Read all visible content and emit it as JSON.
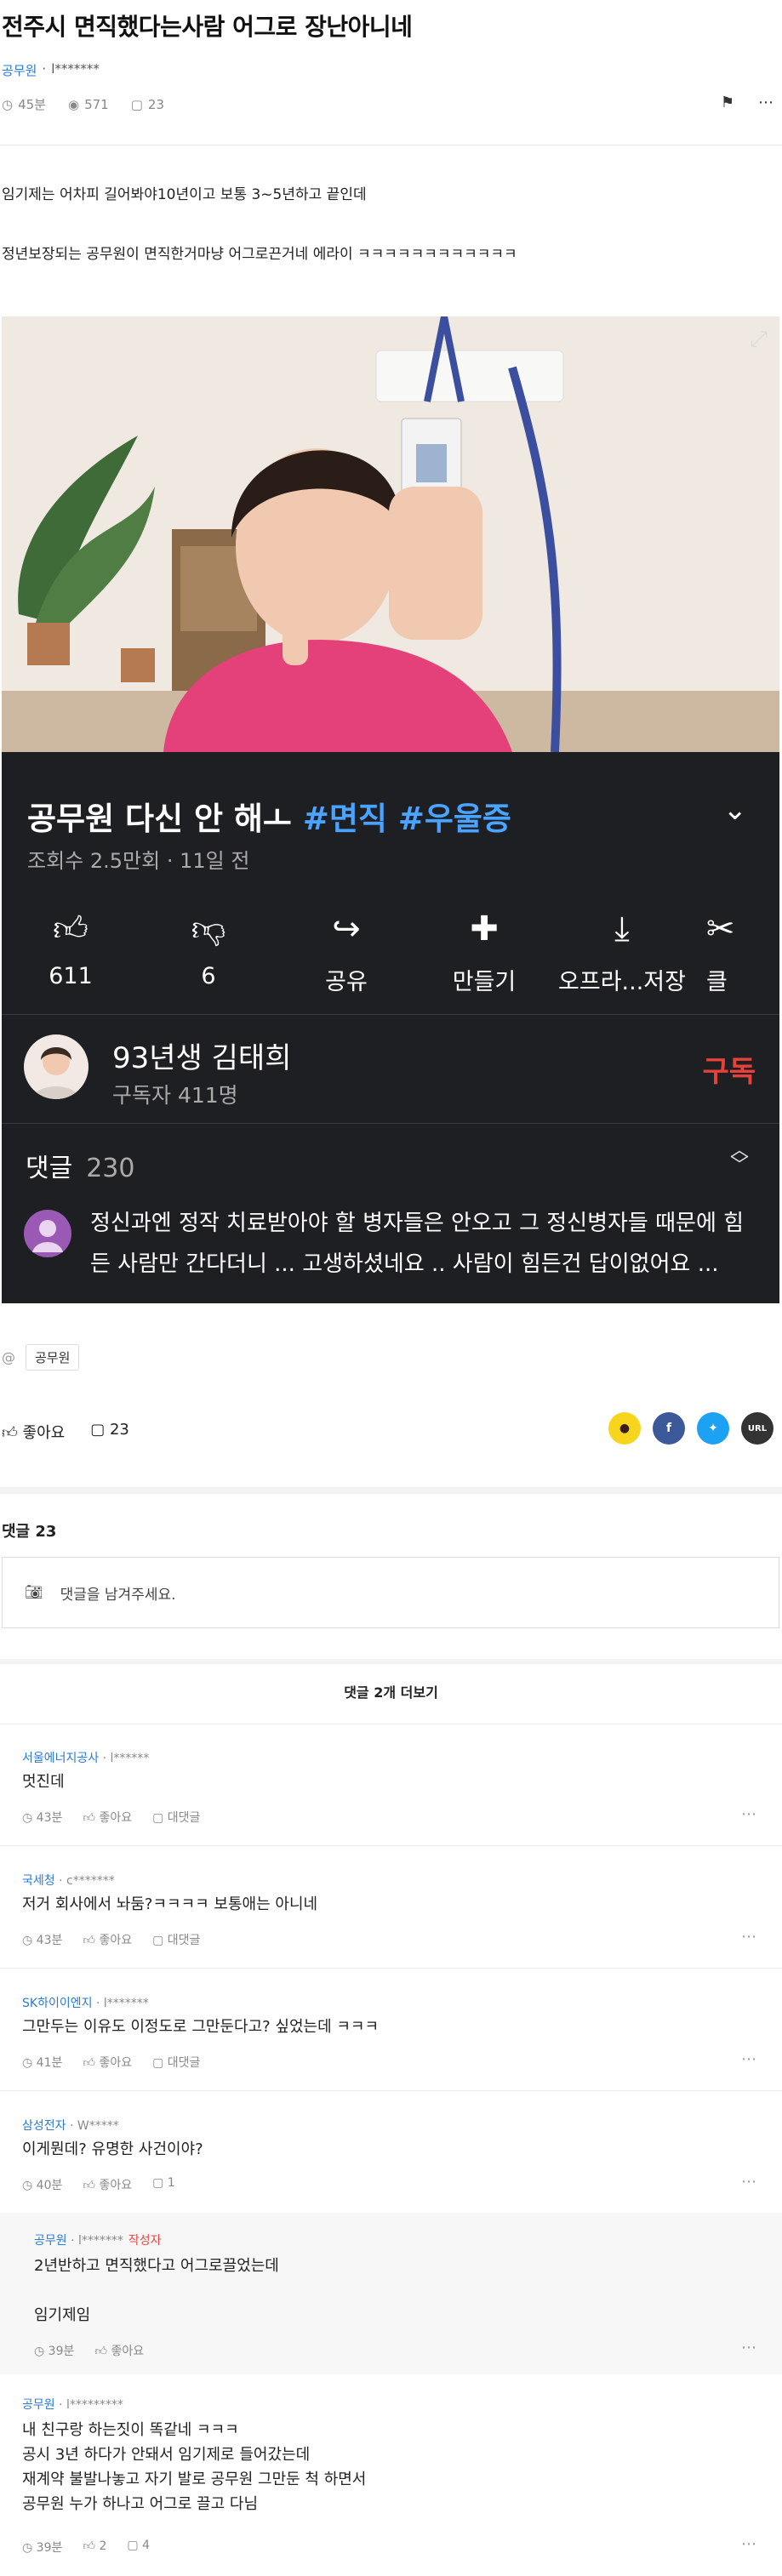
{
  "post": {
    "title": "전주시 면직했다는사람 어그로 장난아니네",
    "company": "공무원",
    "author": "l*******",
    "time": "45분",
    "views": "571",
    "comments": "23",
    "paragraph1": "임기제는 어차피 길어봐야10년이고 보통 3~5년하고 끝인데",
    "paragraph2": "정년보장되는 공무원이 면직한거마냥 어그로끈거네 에라이 ㅋㅋㅋㅋㅋㅋㅋㅋㅋㅋㅋㅋ"
  },
  "video": {
    "title_main": "공무원 다신 안 해ㅗ",
    "tag1": "#면직",
    "tag2": "#우울증",
    "views_date": "조회수 2.5만회 · 11일 전",
    "actions": [
      {
        "icon": "thumb-up-icon",
        "label": "611"
      },
      {
        "icon": "thumb-down-icon",
        "label": "6"
      },
      {
        "icon": "share-icon",
        "label": "공유"
      },
      {
        "icon": "remix-icon",
        "label": "만들기"
      },
      {
        "icon": "download-icon",
        "label": "오프라...저장"
      },
      {
        "icon": "scissors-icon",
        "label": "클"
      }
    ],
    "channel_name": "93년생 김태희",
    "subscribers": "구독자 411명",
    "subscribe_label": "구독",
    "comments_label": "댓글",
    "comments_count": "230",
    "top_comment": "정신과엔 정작 치료받아야 할 병자들은 안오고 그 정신병자들 때문에 힘든 사람만 간다더니 ... 고생하셨네요 .. 사람이 힘든건 답이없어요 ..."
  },
  "tag_label": "공무원",
  "actions": {
    "like_label": "좋아요",
    "comment_count": "23"
  },
  "share": {
    "kakao": "kakao-icon",
    "facebook": "f",
    "twitter": "twitter-icon",
    "url": "URL"
  },
  "comment_section": {
    "header": "댓글 23",
    "placeholder": "댓글을 남겨주세요.",
    "more_label": "댓글 2개 더보기"
  },
  "comments": [
    {
      "company": "서울에너지공사",
      "author": "l******",
      "body": "멋진데",
      "time": "43분",
      "like": "좋아요",
      "reply": "대댓글"
    },
    {
      "company": "국세청",
      "author": "c*******",
      "body": "저거 회사에서 놔둠?ㅋㅋㅋㅋ 보통애는 아니네",
      "time": "43분",
      "like": "좋아요",
      "reply": "대댓글"
    },
    {
      "company": "SK하이이엔지",
      "author": "l*******",
      "body": "그만두는 이유도 이정도로 그만둔다고? 싶었는데 ㅋㅋㅋ",
      "time": "41분",
      "like": "좋아요",
      "reply": "대댓글"
    },
    {
      "company": "삼성전자",
      "author": "W*****",
      "body": "이게뭔데? 유명한 사건이야?",
      "time": "40분",
      "like": "좋아요",
      "reply": "1"
    }
  ],
  "reply": {
    "company": "공무원",
    "author": "l*******",
    "writer_tag": "작성자",
    "line1": "2년반하고 면직했다고 어그로끌었는데",
    "line2": "임기제임",
    "time": "39분",
    "like": "좋아요"
  },
  "last_comment": {
    "company": "공무원",
    "author": "l*********",
    "lines": [
      "내 친구랑 하는짓이 똑같네 ㅋㅋㅋ",
      "공시 3년 하다가 안돼서 임기제로 들어갔는데",
      "재계약 불발나놓고 자기 발로 공무원 그만둔 척 하면서",
      "공무원 누가 하나고 어그로 끌고 다님"
    ],
    "time": "39분",
    "likes": "2",
    "replies": "4"
  },
  "colors": {
    "accent": "#2a7ad6",
    "video_bg": "#1e1f23",
    "hashtag": "#4aa3ff",
    "subscribe": "#e8413a"
  }
}
